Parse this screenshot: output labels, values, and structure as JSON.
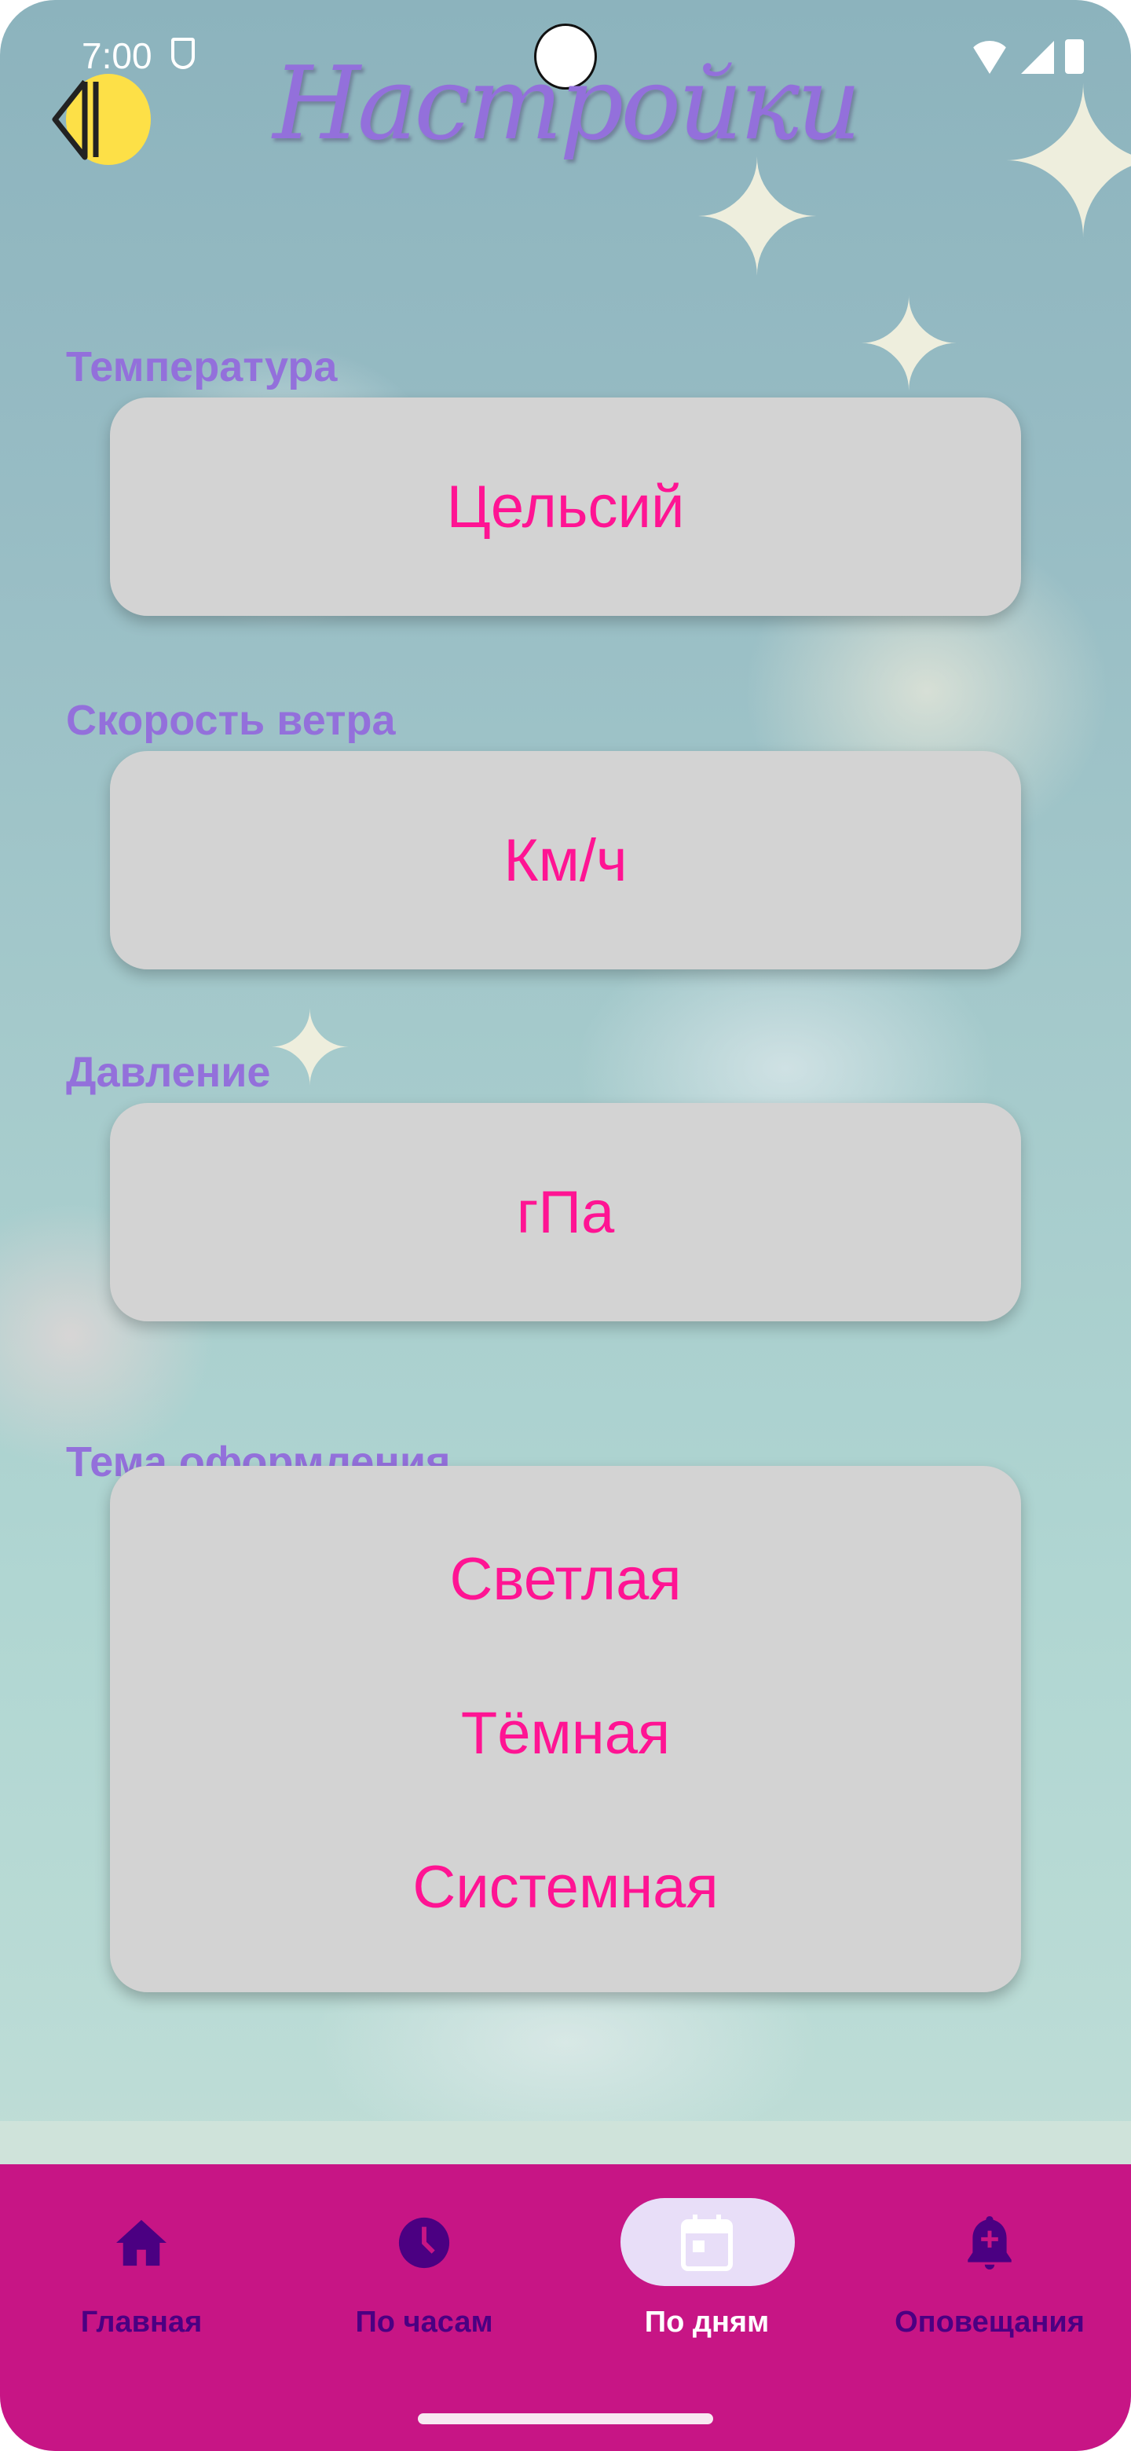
{
  "status_bar": {
    "time": "7:00"
  },
  "header": {
    "title": "Настройки",
    "back_icon": "back-arrow-icon"
  },
  "settings": [
    {
      "label": "Температура",
      "value": "Цельсий"
    },
    {
      "label": "Скорость ветра",
      "value": "Км/ч"
    },
    {
      "label": "Давление",
      "value": "гПа"
    }
  ],
  "theme": {
    "label": "Тема оформления",
    "options": [
      "Светлая",
      "Тёмная",
      "Системная"
    ]
  },
  "bottom_nav": {
    "items": [
      {
        "label": "Главная",
        "icon": "home-icon"
      },
      {
        "label": "По часам",
        "icon": "clock-icon"
      },
      {
        "label": "По дням",
        "icon": "calendar-icon",
        "active": true
      },
      {
        "label": "Оповещания",
        "icon": "bell-plus-icon"
      }
    ]
  },
  "colors": {
    "accent": "#FF1493",
    "label": "#9370DB",
    "nav_bg": "#C71585",
    "nav_icon": "#4B0082",
    "card_bg": "#D3D3D3"
  }
}
